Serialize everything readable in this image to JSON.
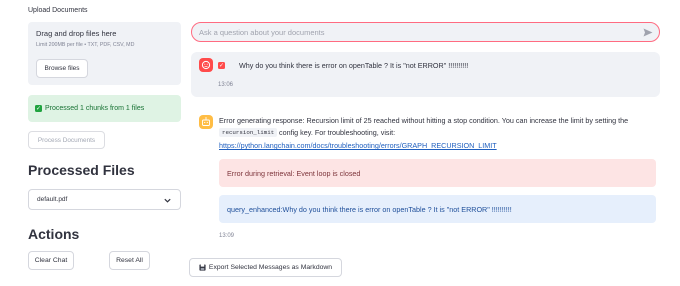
{
  "sidebar": {
    "upload_label": "Upload Documents",
    "dropzone": {
      "title": "Drag and drop files here",
      "limit": "Limit 200MB per file • TXT, PDF, CSV, MD",
      "browse_label": "Browse files"
    },
    "success_message": "Processed 1 chunks from 1 files",
    "process_button": "Process Documents",
    "processed_files_title": "Processed Files",
    "selected_file": "default.pdf",
    "actions_title": "Actions",
    "clear_chat": "Clear Chat",
    "reset_all": "Reset All"
  },
  "chat": {
    "input_placeholder": "Ask a question about your documents",
    "user_message": {
      "text": "Why do you think there is error on openTable ? It is \"not ERROR\" !!!!!!!!!!",
      "time": "13:06"
    },
    "assistant_message": {
      "line1": "Error generating response: Recursion limit of 25 reached without hitting a stop condition. You can increase the limit by setting the",
      "code": "recursion_limit",
      "line2": "config key. For troubleshooting, visit:",
      "link": "https://python.langchain.com/docs/troubleshooting/errors/GRAPH_RECURSION_LIMIT",
      "error_box": "Error during retrieval: Event loop is closed",
      "query_box": "query_enhanced:Why do you think there is error on openTable ? It is \"not ERROR\" !!!!!!!!!!",
      "time": "13:09"
    },
    "export_button": "Export Selected Messages as Markdown"
  },
  "colors": {
    "accent": "#ff4b4b",
    "input_border": "#ff6b81",
    "success_bg": "#dff3e4",
    "error_bg": "#fde4e4",
    "info_bg": "#e6effc",
    "assistant_avatar": "#ffbd45"
  },
  "icons": {
    "user_avatar": "face-icon",
    "assistant_avatar": "robot-icon",
    "send": "send-arrow-icon",
    "export": "floppy-disk-icon",
    "select": "chevron-down-icon",
    "success": "check-box-icon"
  }
}
